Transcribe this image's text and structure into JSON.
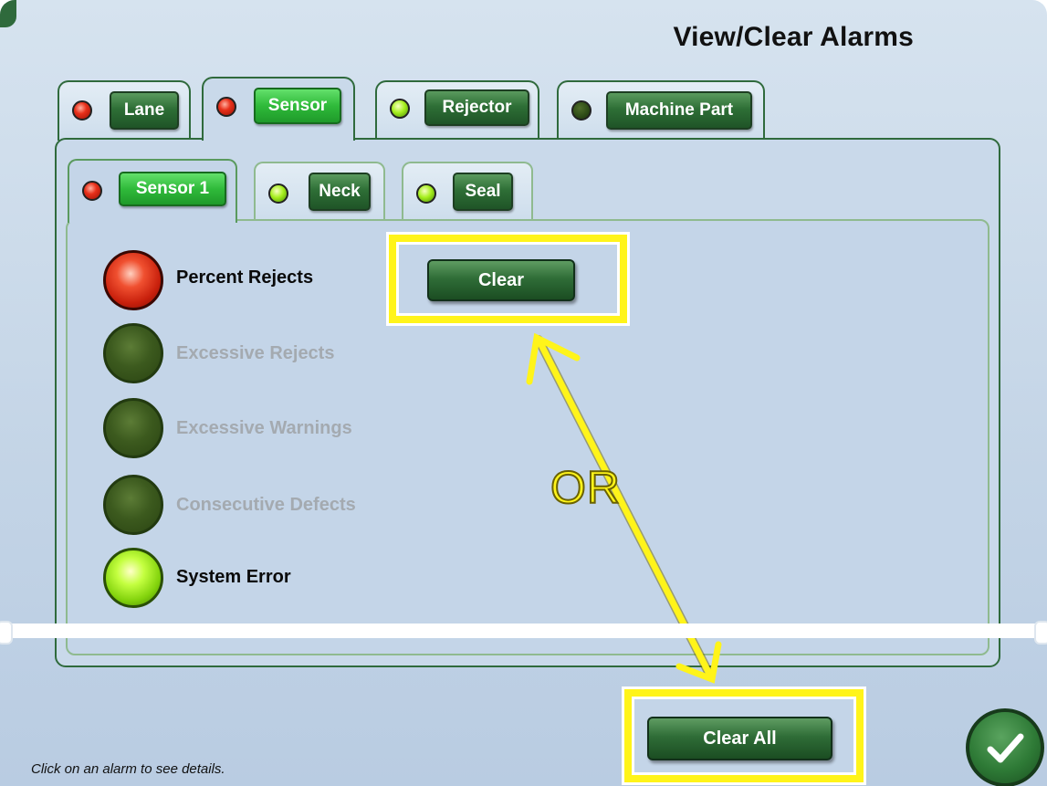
{
  "title": "View/Clear Alarms",
  "main_tabs": [
    {
      "label": "Lane",
      "status": "red",
      "active": false
    },
    {
      "label": "Sensor",
      "status": "red",
      "active": true
    },
    {
      "label": "Rejector",
      "status": "green",
      "active": false
    },
    {
      "label": "Machine Part",
      "status": "dark",
      "active": false
    }
  ],
  "sub_tabs": [
    {
      "label": "Sensor 1",
      "status": "red",
      "active": true
    },
    {
      "label": "Neck",
      "status": "green",
      "active": false
    },
    {
      "label": "Seal",
      "status": "green",
      "active": false
    }
  ],
  "alarms": [
    {
      "label": "Percent Rejects",
      "status": "red",
      "enabled": true
    },
    {
      "label": "Excessive Rejects",
      "status": "dark",
      "enabled": false
    },
    {
      "label": "Excessive Warnings",
      "status": "dark",
      "enabled": false
    },
    {
      "label": "Consecutive Defects",
      "status": "dark",
      "enabled": false
    },
    {
      "label": "System Error",
      "status": "green",
      "enabled": true
    }
  ],
  "clear_button": "Clear",
  "clear_all_button": "Clear All",
  "annotation": "OR",
  "status_text": "Click on an alarm to see details.",
  "ok_icon": "checkmark-icon",
  "colors": {
    "accent_green": "#2f6a3c",
    "highlight": "#fff41a",
    "alarm_red": "#e8301a",
    "alarm_green": "#a6ef1e"
  }
}
